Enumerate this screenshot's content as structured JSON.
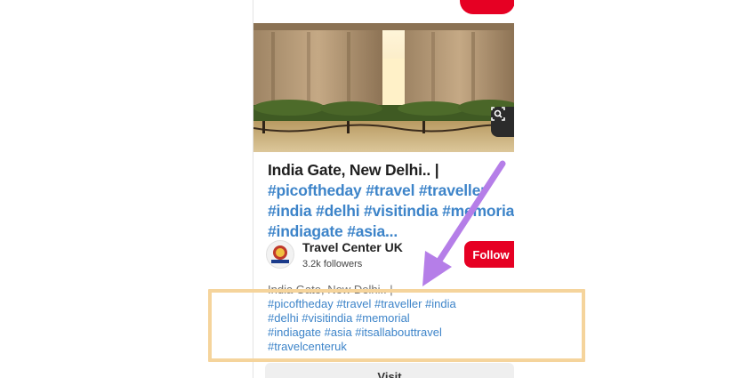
{
  "pin": {
    "title": "India Gate, New Delhi.. |",
    "title_tags": [
      "#picoftheday #travel #traveller",
      "#india #delhi #visitindia #memorial",
      "#indiagate #asia..."
    ]
  },
  "author": {
    "name": "Travel Center UK",
    "followers": "3.2k followers",
    "follow_label": "Follow"
  },
  "description": {
    "first_line": "India Gate, New Delhi.. |",
    "tag_lines": [
      "#picoftheday #travel #traveller #india",
      "#delhi #visitindia #memorial",
      "#indiagate #asia #itsallabouttravel",
      "#travelcenteruk"
    ]
  },
  "visit": {
    "label": "Visit"
  },
  "colors": {
    "accent_red": "#e60023",
    "hashtag_blue": "#3d84c9",
    "highlight": "#f5d49c",
    "arrow": "#b57ee8"
  },
  "icons": {
    "lens": "visual-search-icon"
  }
}
